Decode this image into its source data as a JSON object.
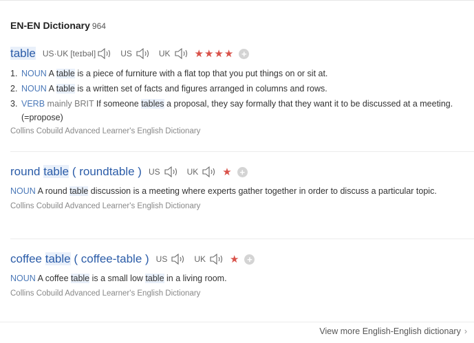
{
  "panel": {
    "title": "EN-EN Dictionary",
    "count": "964",
    "more_link": "View more English-English dictionary",
    "more_icon": "chevron-right"
  },
  "entries": [
    {
      "headword": "table",
      "pron": {
        "us_uk_label": "US·UK",
        "phonetic": "[teɪbəl]",
        "us_label": "US",
        "uk_label": "UK"
      },
      "stars": "★★★★",
      "senses": [
        {
          "num": "1.",
          "pos": "NOUN",
          "pre": "A ",
          "hl": "table",
          "post": " is a piece of furniture with a flat top that you put things on or sit at."
        },
        {
          "num": "2.",
          "pos": "NOUN",
          "pre": "A ",
          "hl": "table",
          "post": " is a written set of facts and figures arranged in columns and rows."
        },
        {
          "num": "3.",
          "pos": "VERB",
          "tag": "mainly BRIT",
          "pre": "If someone ",
          "hl": "tables",
          "post": " a proposal, they say formally that they want it to be discussed at a meeting. (=propose)"
        }
      ],
      "source": "Collins Cobuild Advanced Learner's English Dictionary"
    },
    {
      "headword_pre": "round",
      "headword_hl": "table",
      "headword_alt": "( roundtable )",
      "pron": {
        "us_label": "US",
        "uk_label": "UK"
      },
      "stars": "★",
      "sense": {
        "pos": "NOUN",
        "pre": "A round ",
        "hl": "table",
        "post": " discussion is a meeting where experts gather together in order to discuss a particular topic."
      },
      "source": "Collins Cobuild Advanced Learner's English Dictionary"
    },
    {
      "headword_pre": "coffee",
      "headword_hl": "table",
      "headword_alt": "( coffee-table )",
      "pron": {
        "us_label": "US",
        "uk_label": "UK"
      },
      "stars": "★",
      "sense": {
        "pos": "NOUN",
        "pre": "A coffee ",
        "hl": "table",
        "mid": " is a small low ",
        "hl2": "table",
        "post": " in a living room."
      },
      "source": "Collins Cobuild Advanced Learner's English Dictionary"
    }
  ],
  "icons": {
    "speaker": "speaker-icon",
    "add": "add-icon",
    "star": "star-icon"
  },
  "colors": {
    "headword": "#2b5ca8",
    "pos": "#4a78b8",
    "star": "#d9524a",
    "highlight": "#e9f0fa",
    "source": "#888888"
  }
}
